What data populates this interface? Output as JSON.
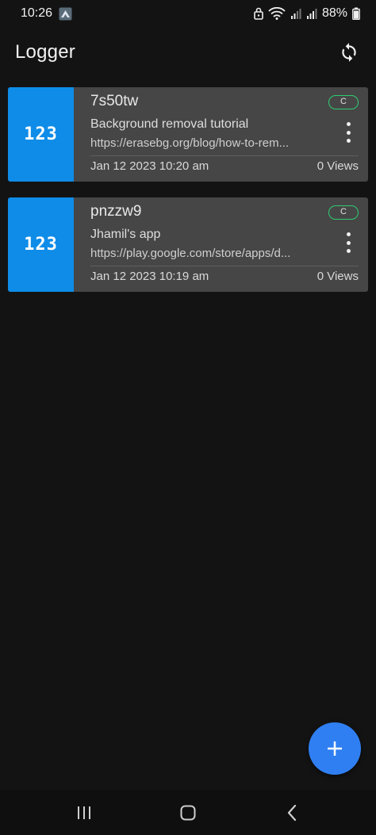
{
  "status_bar": {
    "time": "10:26",
    "battery": "88%",
    "icons": [
      "app-notification-icon",
      "lock-icon",
      "wifi-icon",
      "signal-icon",
      "signal-icon",
      "battery-icon"
    ]
  },
  "app_bar": {
    "title": "Logger",
    "sync_icon": "sync-icon"
  },
  "links": [
    {
      "badge": "123",
      "code": "7s50tw",
      "title": "Background removal tutorial",
      "url": "https://erasebg.org/blog/how-to-rem...",
      "date": "Jan 12 2023 10:20 am",
      "views": "0 Views",
      "chip": "C"
    },
    {
      "badge": "123",
      "code": "pnzzw9",
      "title": "Jhamil's app",
      "url": "https://play.google.com/store/apps/d...",
      "date": "Jan 12 2023 10:19 am",
      "views": "0 Views",
      "chip": "C"
    }
  ],
  "fab": {
    "icon": "plus-icon"
  },
  "nav_bar": {
    "icons": [
      "recents-icon",
      "home-icon",
      "back-icon"
    ]
  },
  "colors": {
    "background": "#131313",
    "card": "#464646",
    "badge": "#0e8ce8",
    "chip_border": "#2ecc71",
    "fab": "#2f7ff2"
  }
}
